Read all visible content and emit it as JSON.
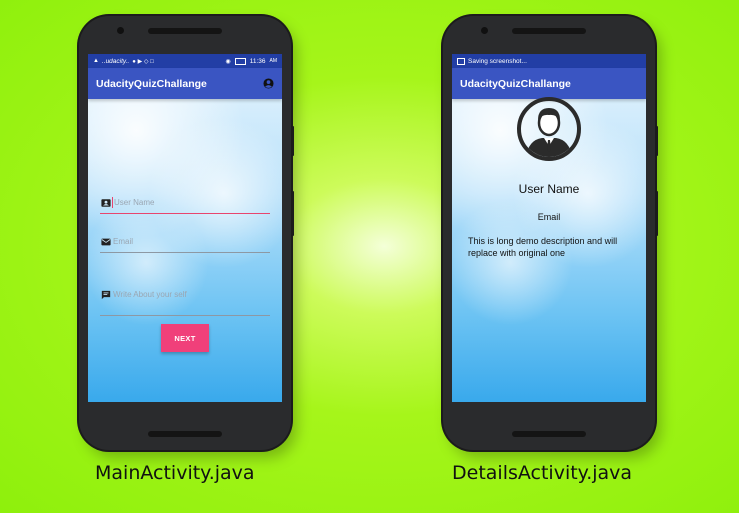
{
  "main_phone": {
    "status_bar": {
      "carrier": "…udacity…",
      "time": "11:36",
      "ampm": "AM"
    },
    "app_title": "UdacityQuizChallange",
    "fields": {
      "user_name_placeholder": "User Name",
      "email_placeholder": "Email",
      "about_placeholder": "Write About your self"
    },
    "next_button": "NEXT",
    "caption": "MainActivity.java"
  },
  "details_phone": {
    "status_bar": {
      "notification": "Saving screenshot..."
    },
    "app_title": "UdacityQuizChallange",
    "user_name": "User Name",
    "email": "Email",
    "description": "This is long demo description and will replace with original one",
    "caption": "DetailsActivity.java"
  },
  "colors": {
    "status_bar": "#223ea5",
    "app_bar": "#3a55c2",
    "accent": "#f0407a",
    "background": "#a6f51a"
  },
  "icons": [
    "account-circle-icon",
    "contact-card-icon",
    "mail-icon",
    "message-icon",
    "person-avatar-icon"
  ]
}
